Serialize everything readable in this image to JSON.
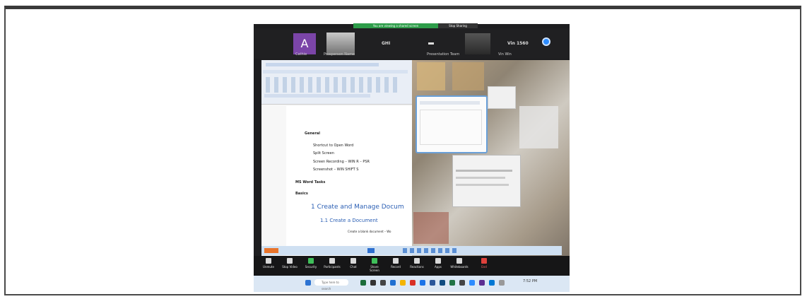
{
  "share_bar": {
    "text": "You are viewing a shared screen",
    "stop": "Stop Sharing"
  },
  "gallery": {
    "tiles": [
      {
        "label": "A",
        "name": "Cathie"
      },
      {
        "label": "",
        "name": "Prosperson Name"
      },
      {
        "label": "GHI",
        "name": ""
      },
      {
        "label": "",
        "name": ""
      },
      {
        "label": "",
        "name": "Presentation Team"
      },
      {
        "label": "Vin 1560",
        "name": "Vin Win"
      }
    ]
  },
  "document": {
    "heading_general": "General",
    "bullets": [
      "Shortcut to Open Word",
      "Split Screen",
      "Screen Recording – WIN R – PSR",
      "Screenshot – WIN SHIFT S"
    ],
    "heading_tasks": "MS Word Tasks",
    "heading_basics": "Basics",
    "section_1": "1   Create and Manage Docum",
    "section_1_1": "1.1   Create a Document",
    "sub_item": "Create a blank document – Wo"
  },
  "meeting_toolbar": {
    "items": [
      "Unmute",
      "Stop Video",
      "Security",
      "Participants",
      "Chat",
      "Share Screen",
      "Record",
      "Reactions",
      "Apps",
      "Whiteboards",
      "End"
    ]
  },
  "taskbar": {
    "search_placeholder": "Type here to search",
    "time": "7:52 PM"
  }
}
